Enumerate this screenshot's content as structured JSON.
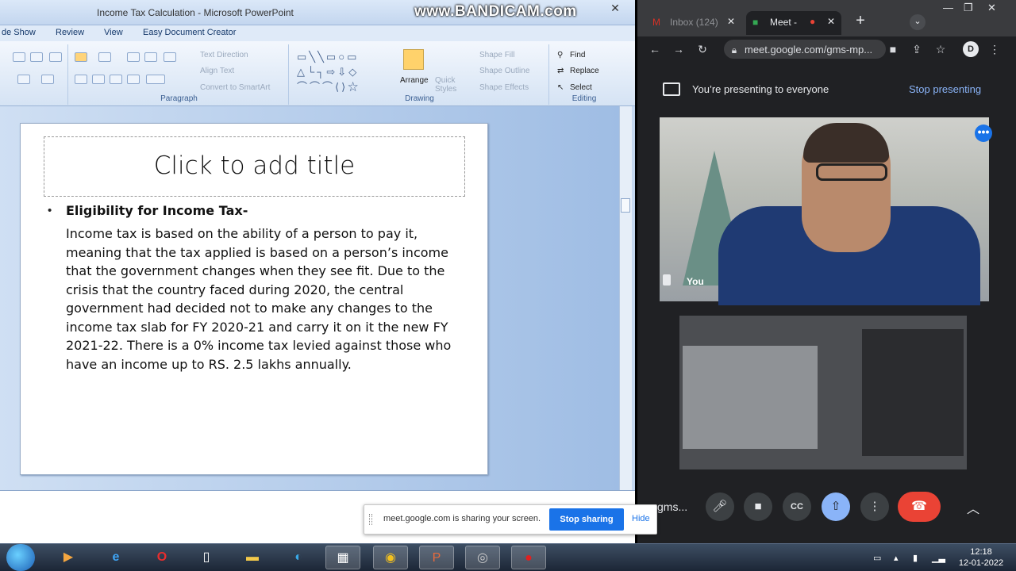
{
  "powerpoint": {
    "window_title": "Income Tax Calculation - Microsoft PowerPoint",
    "watermark": "www.BANDICAM.com",
    "menu": [
      "de Show",
      "Review",
      "View",
      "Easy Document Creator"
    ],
    "ribbon": {
      "text_direction": "Text Direction",
      "align_text": "Align Text",
      "convert_smartart": "Convert to SmartArt",
      "paragraph_label": "Paragraph",
      "arrange": "Arrange",
      "quick_styles": "Quick Styles",
      "shape_fill": "Shape Fill",
      "shape_outline": "Shape Outline",
      "shape_effects": "Shape Effects",
      "drawing_label": "Drawing",
      "find": "Find",
      "replace": "Replace",
      "select": "Select",
      "editing_label": "Editing"
    },
    "slide": {
      "title_placeholder": "Click to add title",
      "heading": "Eligibility for Income Tax-",
      "body": "Income tax is based on the ability of a person to pay it, meaning that the tax applied is based on a person’s income that the government changes when they see fit. Due to the crisis that the country faced during 2020, the central government had decided not to make any changes to the income tax slab for FY 2020-21 and carry it on it the new FY 2021-22. There is a 0% income tax levied against those who have an income  up to RS. 2.5 lakhs annually."
    }
  },
  "chrome": {
    "tabs": [
      {
        "label": "Inbox (124)",
        "active": false
      },
      {
        "label": "Meet - ",
        "active": true
      }
    ],
    "url": "meet.google.com/gms-mp...",
    "profile_initial": "D"
  },
  "meet": {
    "presenting_text": "You’re presenting to everyone",
    "stop_presenting": "Stop presenting",
    "self_label": "You",
    "meeting_code": "gms...",
    "controls": [
      "mic",
      "camera",
      "captions",
      "present",
      "more",
      "end-call"
    ]
  },
  "share_notice": {
    "text": "meet.google.com is sharing your screen.",
    "stop_button": "Stop sharing",
    "hide": "Hide"
  },
  "taskbar": {
    "time": "12:18",
    "date": "12-01-2022"
  },
  "colors": {
    "meet_blue": "#1a73e8",
    "end_call_red": "#ea4335",
    "ppt_ribbon": "#d5e3f4"
  }
}
